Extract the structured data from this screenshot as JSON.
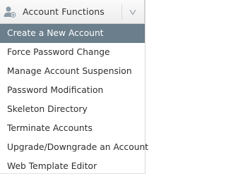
{
  "header": {
    "title": "Account Functions",
    "icon": "user-icon",
    "toggle_icon": "chevron-down-icon"
  },
  "items": [
    {
      "label": "Create a New Account",
      "active": true
    },
    {
      "label": "Force Password Change",
      "active": false
    },
    {
      "label": "Manage Account Suspension",
      "active": false
    },
    {
      "label": "Password Modification",
      "active": false
    },
    {
      "label": "Skeleton Directory",
      "active": false
    },
    {
      "label": "Terminate Accounts",
      "active": false
    },
    {
      "label": "Upgrade/Downgrade an Account",
      "active": false
    },
    {
      "label": "Web Template Editor",
      "active": false
    }
  ],
  "colors": {
    "active_background": "#6b7e8b",
    "active_text": "#ffffff",
    "text": "#2f2f2f",
    "icon": "#8a9aa6"
  }
}
